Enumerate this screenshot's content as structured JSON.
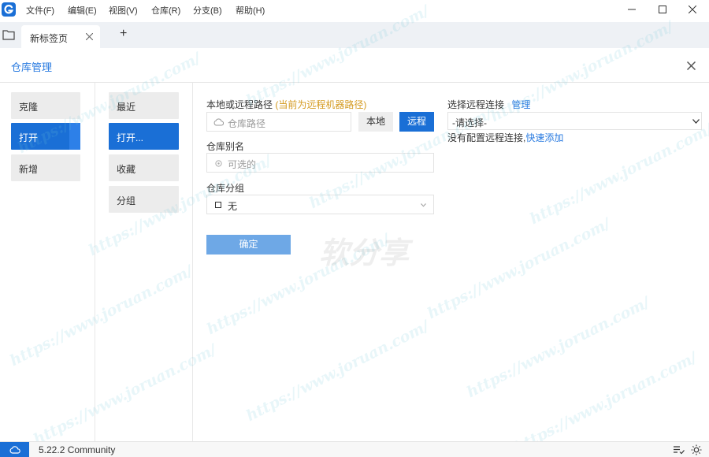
{
  "menu": {
    "items": [
      {
        "label": "文件(F)"
      },
      {
        "label": "编辑(E)"
      },
      {
        "label": "视图(V)"
      },
      {
        "label": "仓库(R)"
      },
      {
        "label": "分支(B)"
      },
      {
        "label": "帮助(H)"
      }
    ]
  },
  "window": {
    "minimize_icon": "minimize-icon",
    "maximize_icon": "maximize-icon",
    "close_icon": "close-icon"
  },
  "tabs": [
    {
      "label": "新标签页",
      "active": true
    }
  ],
  "add_tab_label": "+",
  "dialog": {
    "title": "仓库管理"
  },
  "left_nav": [
    {
      "label": "克隆",
      "active": false
    },
    {
      "label": "打开",
      "active": true
    },
    {
      "label": "新增",
      "active": false
    }
  ],
  "sub_nav": [
    {
      "label": "最近",
      "active": false
    },
    {
      "label": "打开...",
      "active": true
    },
    {
      "label": "收藏",
      "active": false
    },
    {
      "label": "分组",
      "active": false
    }
  ],
  "form": {
    "path_label": "本地或远程路径",
    "path_hint": "(当前为远程机器路径)",
    "path_placeholder": "仓库路径",
    "local_button": "本地",
    "remote_button": "远程",
    "alias_label": "仓库别名",
    "alias_placeholder": "可选的",
    "group_label": "仓库分组",
    "group_value": "无",
    "confirm_button": "确定"
  },
  "remote": {
    "label": "选择远程连接",
    "manage_link": "管理",
    "select_value": "-请选择-",
    "no_config_text": "没有配置远程连接,",
    "quick_add_link": "快速添加"
  },
  "watermark": {
    "text": "https://www.joruan.com/",
    "center_text": "软分享"
  },
  "status": {
    "version": "5.22.2 Community"
  },
  "colors": {
    "accent": "#1a6fd6",
    "link": "#2a7be0",
    "hint": "#d49a1f",
    "confirm_disabled": "#6ea8e6"
  }
}
